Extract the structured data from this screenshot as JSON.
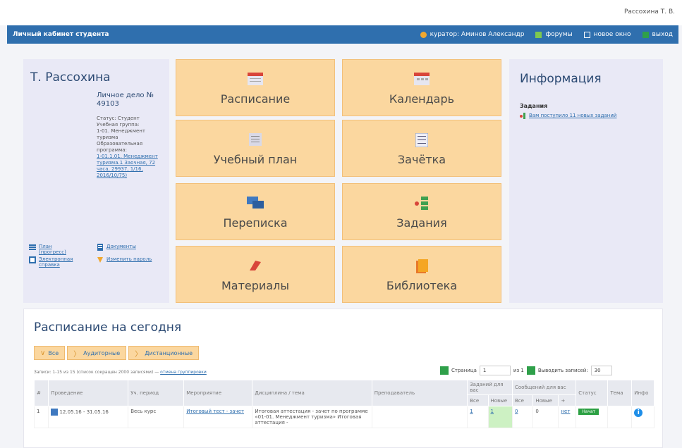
{
  "header": {
    "username": "Рассохина Т. В."
  },
  "navbar": {
    "title": "Личный кабинет студента",
    "items": [
      {
        "label": "куратор: Аминов Александр",
        "icon": "curator-icon"
      },
      {
        "label": "форумы",
        "icon": "forum-icon"
      },
      {
        "label": "новое окно",
        "icon": "new-window-icon"
      },
      {
        "label": "выход",
        "icon": "exit-icon"
      }
    ]
  },
  "profile": {
    "name": "Т. Рассохина",
    "dossier": "Личное дело № 49103",
    "status": "Статус: Студент",
    "group_label": "Учебная группа:",
    "group_value": "1-01. Менеджмент туризма",
    "program_label": "Образовательная программа:",
    "program_link": "1-01.1.01. Менеджмент туризма.1 Заочная, 72 часа, 29937, 1/16, 2016/10/75)",
    "links": [
      {
        "label": "План (прогресс)",
        "icon": "plan-icon"
      },
      {
        "label": "Документы",
        "icon": "documents-icon"
      },
      {
        "label": "Электронная справка",
        "icon": "certificate-icon"
      },
      {
        "label": "Изменить пароль",
        "icon": "password-icon"
      }
    ]
  },
  "tiles": [
    {
      "label": "Расписание",
      "icon": "schedule-icon"
    },
    {
      "label": "Календарь",
      "icon": "calendar-icon"
    },
    {
      "label": "Учебный план",
      "icon": "study-plan-icon"
    },
    {
      "label": "Зачётка",
      "icon": "record-book-icon"
    },
    {
      "label": "Переписка",
      "icon": "messages-icon"
    },
    {
      "label": "Задания",
      "icon": "tasks-icon"
    },
    {
      "label": "Материалы",
      "icon": "materials-icon"
    },
    {
      "label": "Библиотека",
      "icon": "library-icon"
    }
  ],
  "info": {
    "title": "Информация",
    "subtitle": "Задания",
    "link": "Вам поступило 11 новых заданий"
  },
  "schedule": {
    "title": "Расписание на сегодня",
    "filters": [
      "Все",
      "Аудиторные",
      "Дистанционные"
    ],
    "summary": "Записи: 1-15 из 15 (список сокращен 2000 записями) —",
    "summary_link": "отмена группировки",
    "pager": {
      "page_label": "Страница",
      "page": "1",
      "of": "из 1",
      "per_page_label": "Выводить записей:",
      "per_page": "30"
    },
    "columns": [
      "#",
      "Проведение",
      "Уч. период",
      "Мероприятие",
      "Дисциплина / тема",
      "Преподаватель",
      "Заданий для вас",
      "Сообщений для вас",
      "Статус",
      "Тема",
      "Инфо"
    ],
    "subcolumns": {
      "tasks": [
        "Все",
        "Новые"
      ],
      "messages": [
        "Все",
        "Новые",
        "+"
      ]
    },
    "rows": [
      {
        "n": "1",
        "dates": "12.05.16 - 31.05.16",
        "period": "Весь курс",
        "event": "Итоговый тест - зачет",
        "discipline": "Итоговая аттестация - зачет по программе «01-01. Менеджмент туризма» Итоговая аттестация -",
        "teacher": "",
        "tasks_all": "1",
        "tasks_new": "1",
        "msg_all": "0",
        "msg_new": "0",
        "msg_add": "нет",
        "status": "Начат",
        "info": "i"
      }
    ]
  },
  "colors": {
    "navbar": "#2f6fae",
    "tile": "#fbd79f",
    "panel": "#e9e9f6",
    "title": "#2c4a73"
  }
}
